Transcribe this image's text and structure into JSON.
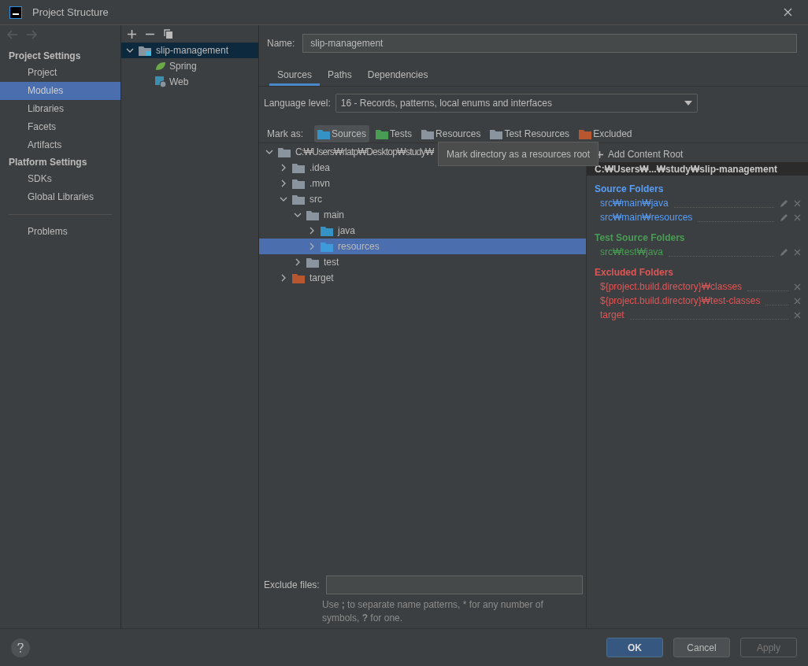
{
  "window": {
    "title": "Project Structure"
  },
  "nav": {
    "back_disabled": true,
    "forward_disabled": true
  },
  "sidebar": {
    "sections": [
      {
        "title": "Project Settings",
        "items": [
          {
            "label": "Project",
            "selected": false
          },
          {
            "label": "Modules",
            "selected": true
          },
          {
            "label": "Libraries",
            "selected": false
          },
          {
            "label": "Facets",
            "selected": false
          },
          {
            "label": "Artifacts",
            "selected": false
          }
        ]
      },
      {
        "title": "Platform Settings",
        "items": [
          {
            "label": "SDKs",
            "selected": false
          },
          {
            "label": "Global Libraries",
            "selected": false
          }
        ]
      }
    ],
    "extra_items": [
      {
        "label": "Problems",
        "selected": false
      }
    ]
  },
  "modules": [
    {
      "label": "slip-management",
      "expanded": true,
      "selected": true,
      "children": [
        {
          "label": "Spring",
          "kind": "spring",
          "selected": false
        },
        {
          "label": "Web",
          "kind": "web",
          "selected": false
        }
      ]
    }
  ],
  "name_field": {
    "label": "Name:",
    "value": "slip-management"
  },
  "tabs": [
    {
      "label": "Sources",
      "selected": true
    },
    {
      "label": "Paths",
      "selected": false
    },
    {
      "label": "Dependencies",
      "selected": false
    }
  ],
  "language_level": {
    "label": "Language level:",
    "value": "16 - Records, patterns, local enums and interfaces"
  },
  "mark_as": {
    "label": "Mark as:",
    "buttons": [
      {
        "label": "Sources",
        "color": "#3592c4",
        "selected": true
      },
      {
        "label": "Tests",
        "color": "#499c54",
        "selected": false
      },
      {
        "label": "Resources",
        "color": "#8a949e",
        "selected": false
      },
      {
        "label": "Test Resources",
        "color": "#8a949e",
        "selected": false
      },
      {
        "label": "Excluded",
        "color": "#b8572f",
        "selected": false
      }
    ]
  },
  "tooltip": "Mark directory as a resources root",
  "tree": [
    {
      "label": "C:₩Users₩rlatp₩Desktop₩study₩",
      "kind": "plain",
      "expanded": true,
      "selected": false,
      "children": [
        {
          "label": ".idea",
          "kind": "plain",
          "expanded": false,
          "selected": false
        },
        {
          "label": ".mvn",
          "kind": "plain",
          "expanded": false,
          "selected": false
        },
        {
          "label": "src",
          "kind": "plain",
          "expanded": true,
          "selected": false,
          "children": [
            {
              "label": "main",
              "kind": "plain",
              "expanded": true,
              "selected": false,
              "children": [
                {
                  "label": "java",
                  "kind": "source",
                  "expanded": false,
                  "selected": false
                },
                {
                  "label": "resources",
                  "kind": "resource",
                  "expanded": false,
                  "selected": true
                }
              ]
            },
            {
              "label": "test",
              "kind": "plain",
              "expanded": false,
              "selected": false
            }
          ]
        },
        {
          "label": "target",
          "kind": "excluded",
          "expanded": false,
          "selected": false
        }
      ]
    }
  ],
  "content_root": {
    "add_label": "Add Content Root",
    "path": "C:₩Users₩...₩study₩slip-management",
    "groups": [
      {
        "title": "Source Folders",
        "color": "#589df6",
        "editable": true,
        "items": [
          "src₩main₩java",
          "src₩main₩resources"
        ]
      },
      {
        "title": "Test Source Folders",
        "color": "#499c54",
        "editable": true,
        "items": [
          "src₩test₩java"
        ]
      },
      {
        "title": "Excluded Folders",
        "color": "#e05555",
        "editable": false,
        "items": [
          "${project.build.directory}₩classes",
          "${project.build.directory}₩test-classes",
          "target"
        ]
      }
    ]
  },
  "exclude_files": {
    "label": "Exclude files:",
    "hint": "Use **;** to separate name patterns, * for any number of symbols, **?** for one."
  },
  "buttons": [
    {
      "label": "OK",
      "kind": "primary",
      "disabled": false
    },
    {
      "label": "Cancel",
      "kind": "normal",
      "disabled": false
    },
    {
      "label": "Apply",
      "kind": "normal",
      "disabled": true
    }
  ]
}
